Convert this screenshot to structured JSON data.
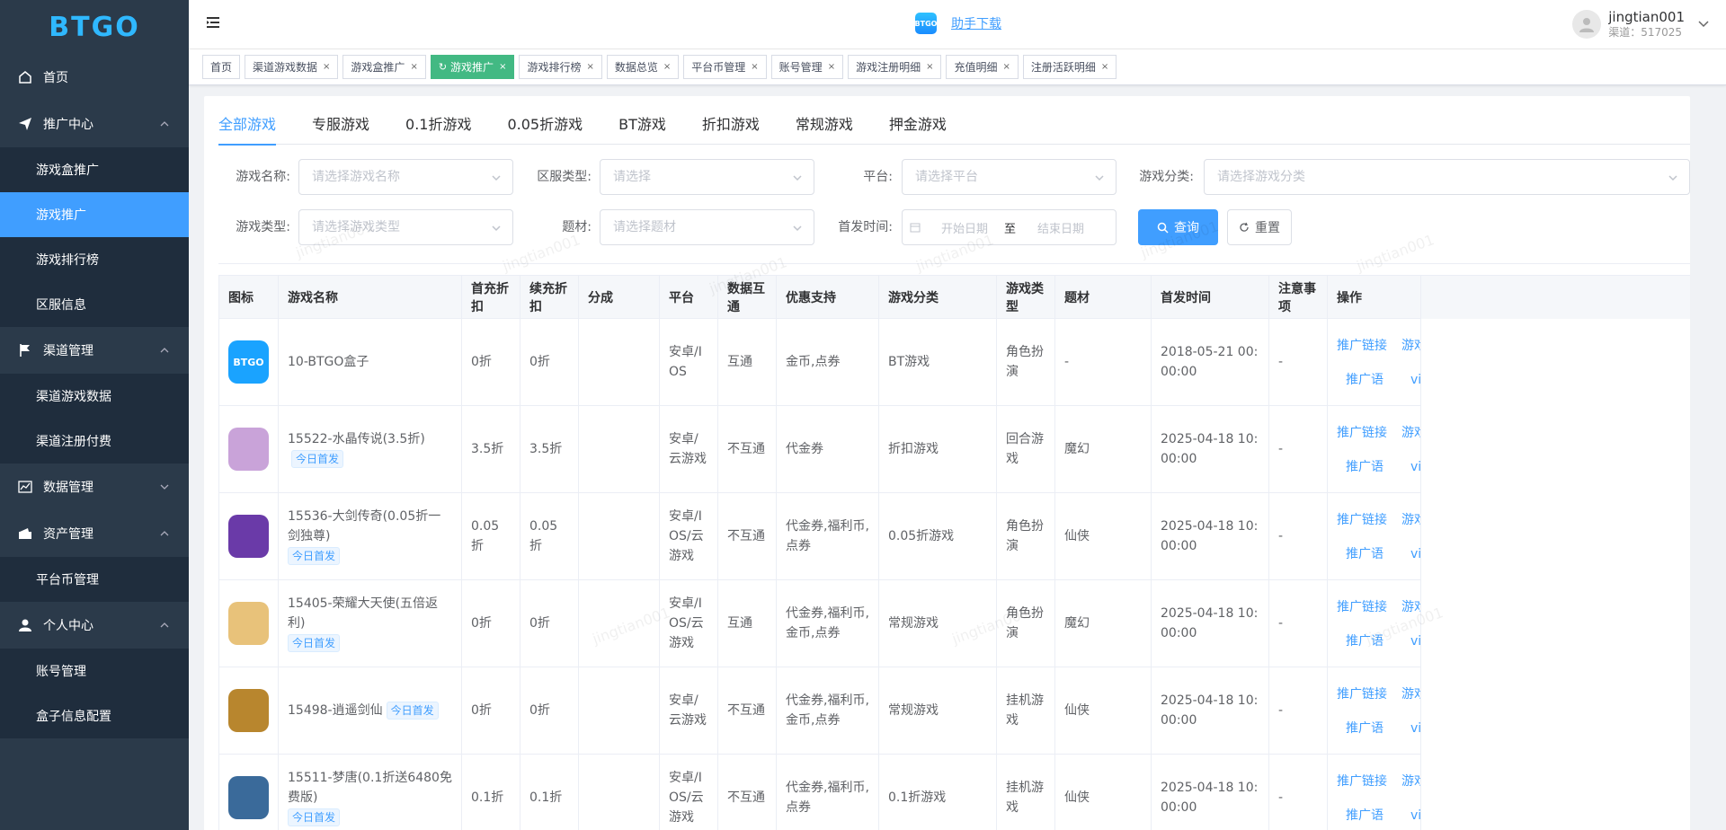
{
  "brand": {
    "logo_text": "BTGO"
  },
  "sidebar": {
    "home": "首页",
    "groups": [
      {
        "label": "推广中心",
        "items": [
          "游戏盒推广",
          "游戏推广",
          "游戏排行榜",
          "区服信息"
        ]
      },
      {
        "label": "渠道管理",
        "items": [
          "渠道游戏数据",
          "渠道注册付费"
        ]
      },
      {
        "label": "数据管理",
        "items": []
      },
      {
        "label": "资产管理",
        "items": [
          "平台币管理"
        ]
      },
      {
        "label": "个人中心",
        "items": [
          "账号管理",
          "盒子信息配置"
        ]
      }
    ],
    "active": "游戏推广"
  },
  "header": {
    "download_icon_text": "BTGO",
    "download_label": "助手下载",
    "username": "jingtian001",
    "channel": "渠道：517025"
  },
  "tags": [
    "首页",
    "渠道游戏数据",
    "游戏盒推广",
    "游戏推广",
    "游戏排行榜",
    "数据总览",
    "平台币管理",
    "账号管理",
    "游戏注册明细",
    "充值明细",
    "注册活跃明细"
  ],
  "tabs": [
    "全部游戏",
    "专服游戏",
    "0.1折游戏",
    "0.05折游戏",
    "BT游戏",
    "折扣游戏",
    "常规游戏",
    "押金游戏"
  ],
  "filters": {
    "game_name": {
      "label": "游戏名称:",
      "placeholder": "请选择游戏名称"
    },
    "server_type": {
      "label": "区服类型:",
      "placeholder": "请选择"
    },
    "platform": {
      "label": "平台:",
      "placeholder": "请选择平台"
    },
    "category": {
      "label": "游戏分类:",
      "placeholder": "请选择游戏分类"
    },
    "game_type": {
      "label": "游戏类型:",
      "placeholder": "请选择游戏类型"
    },
    "theme": {
      "label": "题材:",
      "placeholder": "请选择题材"
    },
    "release": {
      "label": "首发时间:",
      "start": "开始日期",
      "sep": "至",
      "end": "结束日期"
    },
    "query_label": "查询",
    "reset_label": "重置"
  },
  "table": {
    "headers": [
      "图标",
      "游戏名称",
      "首充折扣",
      "续充折扣",
      "分成",
      "平台",
      "数据互通",
      "优惠支持",
      "游戏分类",
      "游戏类型",
      "题材",
      "首发时间",
      "注意事项",
      "操作"
    ],
    "badge": "今日首发",
    "ops": [
      "推广链接",
      "游戏素材",
      "推广语",
      "vip介绍"
    ],
    "rows": [
      {
        "name": "10-BTGO盒子",
        "badge": false,
        "first": "0折",
        "renew": "0折",
        "share": "",
        "platform": "安卓/IOS",
        "sync": "互通",
        "promo": "金币,点券",
        "category": "BT游戏",
        "type": "角色扮演",
        "theme": "-",
        "date": "2018-05-21 00:00:00",
        "note": "-",
        "icon_color": "#1aa3ff"
      },
      {
        "name": "15522-水晶传说(3.5折)",
        "badge": true,
        "badge_inline": true,
        "first": "3.5折",
        "renew": "3.5折",
        "share": "",
        "platform": "安卓/云游戏",
        "sync": "不互通",
        "promo": "代金券",
        "category": "折扣游戏",
        "type": "回合游戏",
        "theme": "魔幻",
        "date": "2025-04-18 10:00:00",
        "note": "-",
        "icon_color": "#c9a3d9"
      },
      {
        "name": "15536-大剑传奇(0.05折一剑独尊)",
        "badge": true,
        "badge_inline": false,
        "first": "0.05折",
        "renew": "0.05折",
        "share": "",
        "platform": "安卓/IOS/云游戏",
        "sync": "不互通",
        "promo": "代金券,福利币,点券",
        "category": "0.05折游戏",
        "type": "角色扮演",
        "theme": "仙侠",
        "date": "2025-04-18 10:00:00",
        "note": "-",
        "icon_color": "#6a3aa8"
      },
      {
        "name": "15405-荣耀大天使(五倍返利)",
        "badge": true,
        "badge_inline": false,
        "first": "0折",
        "renew": "0折",
        "share": "",
        "platform": "安卓/IOS/云游戏",
        "sync": "互通",
        "promo": "代金券,福利币,金币,点券",
        "category": "常规游戏",
        "type": "角色扮演",
        "theme": "魔幻",
        "date": "2025-04-18 10:00:00",
        "note": "-",
        "icon_color": "#e8c27a"
      },
      {
        "name": "15498-逍遥剑仙",
        "badge": true,
        "badge_inline": true,
        "first": "0折",
        "renew": "0折",
        "share": "",
        "platform": "安卓/云游戏",
        "sync": "不互通",
        "promo": "代金券,福利币,金币,点券",
        "category": "常规游戏",
        "type": "挂机游戏",
        "theme": "仙侠",
        "date": "2025-04-18 10:00:00",
        "note": "-",
        "icon_color": "#b8862e"
      },
      {
        "name": "15511-梦唐(0.1折送6480免费版)",
        "badge": true,
        "badge_inline": false,
        "first": "0.1折",
        "renew": "0.1折",
        "share": "",
        "platform": "安卓/IOS/云游戏",
        "sync": "不互通",
        "promo": "代金券,福利币,点券",
        "category": "0.1折游戏",
        "type": "挂机游戏",
        "theme": "仙侠",
        "date": "2025-04-18 10:00:00",
        "note": "-",
        "icon_color": "#3a6a9a"
      }
    ]
  },
  "watermark_text": "jingtian001"
}
